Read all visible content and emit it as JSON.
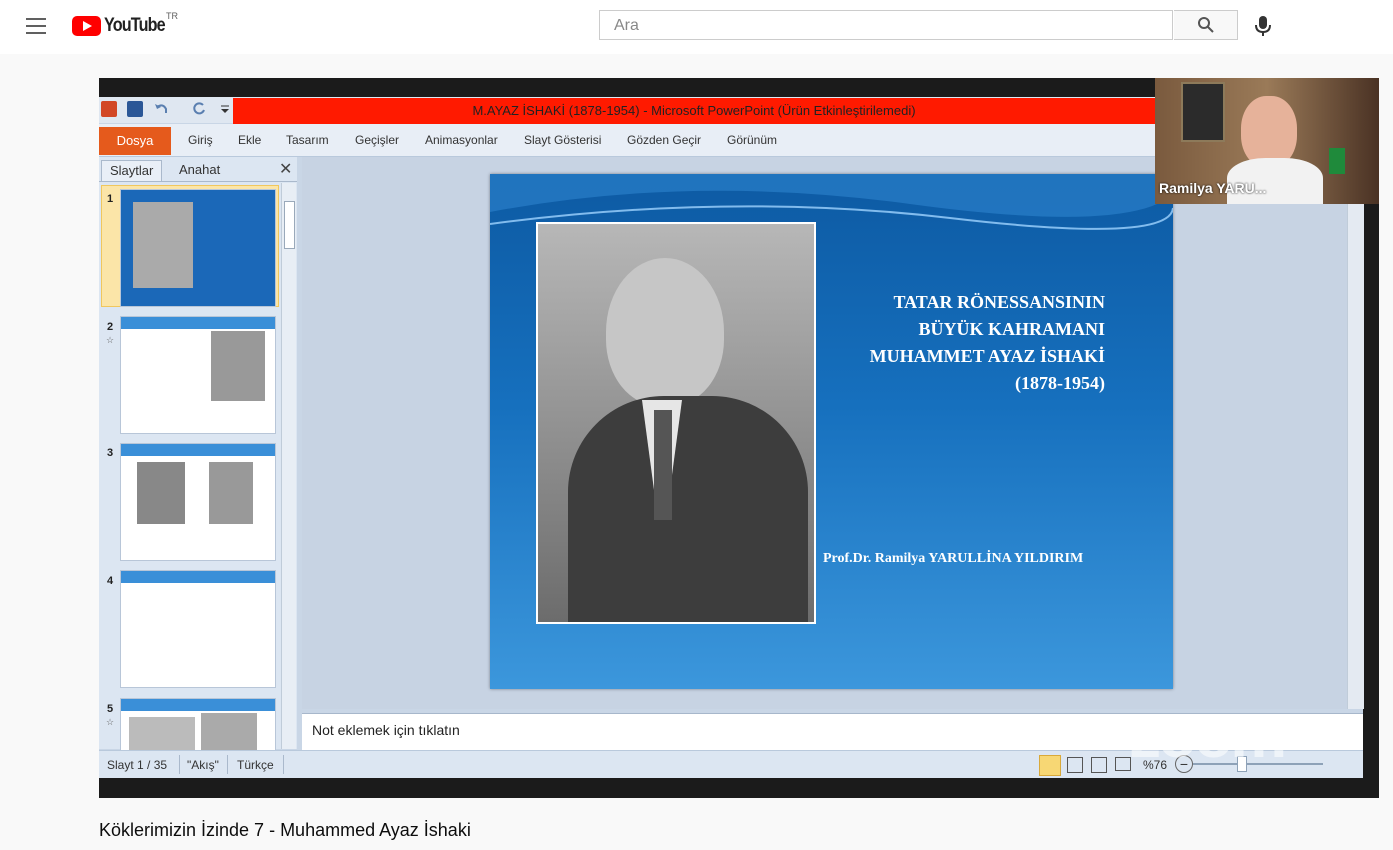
{
  "header": {
    "country_code": "TR",
    "logo_text": "YouTube",
    "search_placeholder": "Ara"
  },
  "video": {
    "title": "Köklerimizin İzinde 7 - Muhammed Ayaz İshaki"
  },
  "powerpoint": {
    "window_title": "M.AYAZ İSHAKİ (1878-1954) - Microsoft PowerPoint (Ürün Etkinleştirilemedi)",
    "file_tab": "Dosya",
    "ribbon_tabs": [
      "Giriş",
      "Ekle",
      "Tasarım",
      "Geçişler",
      "Animasyonlar",
      "Slayt Gösterisi",
      "Gözden Geçir",
      "Görünüm"
    ],
    "panel_tabs": [
      "Slaytlar",
      "Anahat"
    ],
    "thumbnails": [
      "1",
      "2",
      "3",
      "4",
      "5"
    ],
    "slide": {
      "title_lines": [
        "TATAR RÖNESSANSININ",
        "BÜYÜK KAHRAMANI",
        "MUHAMMET AYAZ İSHAKİ",
        "(1878-1954)"
      ],
      "author": "Prof.Dr. Ramilya YARULLİNA YILDIRIM"
    },
    "notes_placeholder": "Not eklemek için tıklatın",
    "status": {
      "slide_counter": "Slayt 1 / 35",
      "theme": "\"Akış\"",
      "language": "Türkçe",
      "zoom": "%76"
    }
  },
  "webcam": {
    "participant_name": "Ramilya YARU..."
  },
  "watermark": "zoom",
  "colors": {
    "youtube_red": "#ff0000",
    "titlebar_red": "#ff1a00",
    "file_tab_orange": "#e55a1c",
    "slide_blue": "#1670be"
  }
}
